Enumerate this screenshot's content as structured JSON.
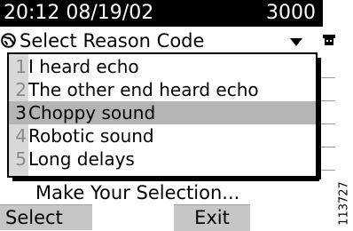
{
  "status_bar": {
    "datetime": "20:12 08/19/02",
    "extension": "3000"
  },
  "header": {
    "title": "Select Reason Code",
    "icon": "globe-icon",
    "caret": "dropdown-caret-icon"
  },
  "side_icon": "phone-icon",
  "options": [
    {
      "num": "1",
      "label": "I heard echo",
      "selected": false
    },
    {
      "num": "2",
      "label": "The other end heard echo",
      "selected": false
    },
    {
      "num": "3",
      "label": "Choppy sound",
      "selected": true
    },
    {
      "num": "4",
      "label": "Robotic sound",
      "selected": false
    },
    {
      "num": "5",
      "label": "Long delays",
      "selected": false
    }
  ],
  "prompt": "Make Your Selection...",
  "softkeys": {
    "select": "Select",
    "exit": "Exit"
  },
  "figure_code": "113727",
  "colors": {
    "status_bg": "#000000",
    "selected_bg": "#b4b4b4",
    "softkey_bg": "#c6c6c6",
    "gutter_bg": "#d8d8d8"
  }
}
